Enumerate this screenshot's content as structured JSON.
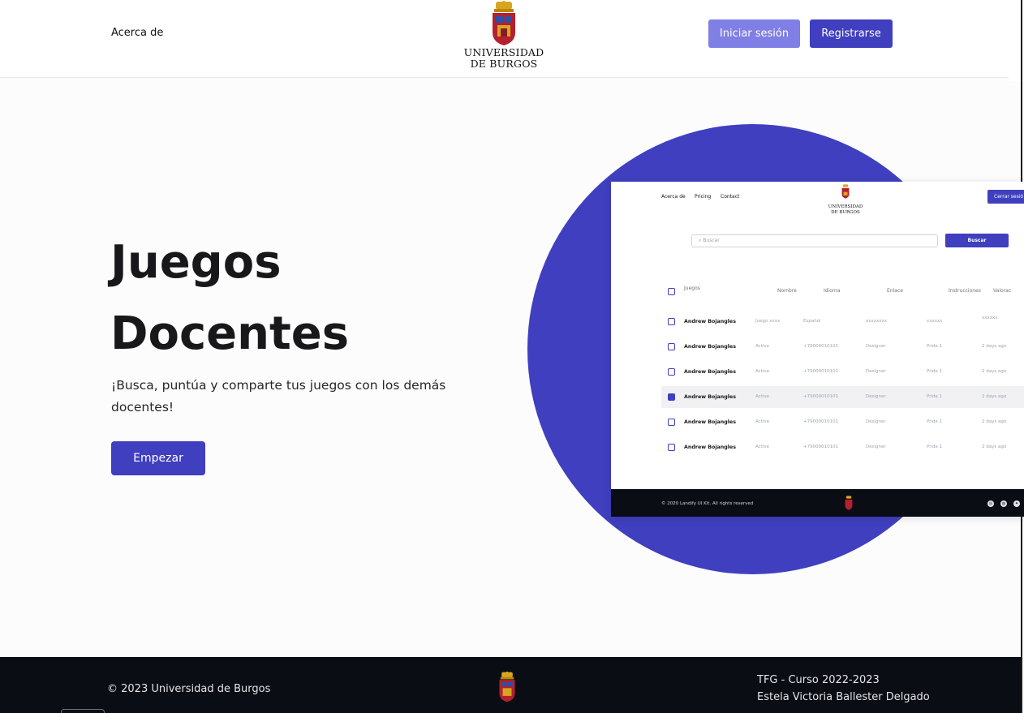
{
  "header": {
    "nav_about": "Acerca de",
    "logo_line1": "UNIVERSIDAD",
    "logo_line2": "DE BURGOS",
    "login_label": "Iniciar sesión",
    "register_label": "Registrarse"
  },
  "hero": {
    "title_line1": "Juegos",
    "title_line2": "Docentes",
    "description": "¡Busca, puntúa y comparte tus juegos con los demás docentes!",
    "start_label": "Empezar"
  },
  "colors": {
    "accent": "#3f3fbf",
    "accent_light": "#7f7fe6",
    "footer_bg": "#0b0d14"
  },
  "mockup": {
    "nav": [
      "Acerca de",
      "Pricing",
      "Contact"
    ],
    "logo_line1": "UNIVERSIDAD",
    "logo_line2": "DE BURGOS",
    "logout_label": "Cerrar sesió",
    "search_placeholder": "Buscar",
    "search_button": "Buscar",
    "columns": [
      "Juegos",
      "Nombre",
      "Idioma",
      "Enlace",
      "Instrucciones",
      "Valorac"
    ],
    "rows": [
      {
        "name": "Andrew Bojangles",
        "c1": "Juego xxxx",
        "c2": "Español",
        "c3": "xxxxxxxx",
        "c4": "xxxxxx",
        "c5": "xxxxxx",
        "checked": false
      },
      {
        "name": "Andrew Bojangles",
        "c1": "Active",
        "c2": "+79000010101",
        "c3": "Designer",
        "c4": "Pride 1",
        "c5": "2 days ago",
        "checked": false
      },
      {
        "name": "Andrew Bojangles",
        "c1": "Active",
        "c2": "+79000010101",
        "c3": "Designer",
        "c4": "Pride 1",
        "c5": "2 days ago",
        "checked": false
      },
      {
        "name": "Andrew Bojangles",
        "c1": "Active",
        "c2": "+79000010101",
        "c3": "Designer",
        "c4": "Pride 1",
        "c5": "2 days ago",
        "checked": true
      },
      {
        "name": "Andrew Bojangles",
        "c1": "Active",
        "c2": "+79000010101",
        "c3": "Designer",
        "c4": "Pride 1",
        "c5": "2 days ago",
        "checked": false
      },
      {
        "name": "Andrew Bojangles",
        "c1": "Active",
        "c2": "+79000010101",
        "c3": "Designer",
        "c4": "Pride 1",
        "c5": "2 days ago",
        "checked": false
      }
    ],
    "footer_text": "© 2020 Landify UI Kit. All rights reserved",
    "social_icons": [
      "instagram-icon",
      "dribbble-icon",
      "twitter-icon"
    ]
  },
  "footer": {
    "copyright": "© 2023 Universidad de Burgos",
    "course": "TFG - Curso 2022-2023",
    "author": "Estela Victoria Ballester Delgado"
  }
}
